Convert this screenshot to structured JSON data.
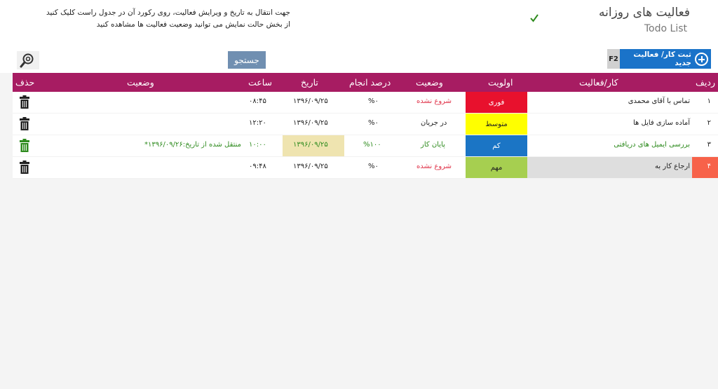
{
  "header": {
    "title": "فعالیت های روزانه",
    "subtitle": "Todo List",
    "hint_line1": "جهت انتقال به تاریخ و ویرایش فعالیت، روی رکورد آن در جدول راست کلیک کنید",
    "hint_line2": "از بخش حالت نمایش می توانید  وضعیت فعالیت ها مشاهده کنید"
  },
  "toolbar": {
    "add_label": "ثبت کار/ فعالیت جدید",
    "add_shortcut": "F2",
    "search_label": "جستجو",
    "search_value": "",
    "search_placeholder": ""
  },
  "table": {
    "columns": {
      "row": "ردیف",
      "task": "کار/فعالیت",
      "priority": "اولویت",
      "status": "وضعیت",
      "percent": "درصد انجام",
      "date": "تاریخ",
      "time": "ساعت",
      "state": "وضعیت",
      "delete": "حذف"
    },
    "rows": [
      {
        "num": "۱",
        "task": "تماس با آقای محمدی",
        "priority": "فوری",
        "priority_color": "#e8112d",
        "priority_text_color": "#ffffff",
        "status": "شروع نشده",
        "percent": "%۰",
        "date": "۱۳۹۶/۰۹/۲۵",
        "time": "۰۸:۴۵",
        "state": ""
      },
      {
        "num": "۲",
        "task": "آماده سازی فایل ها",
        "priority": "متوسط",
        "priority_color": "#ffff00",
        "priority_text_color": "#222222",
        "status": "در جریان",
        "percent": "%۰",
        "date": "۱۳۹۶/۰۹/۲۵",
        "time": "۱۲:۲۰",
        "state": ""
      },
      {
        "num": "۳",
        "task": "بررسی ایمیل های دریافتی",
        "priority": "کم",
        "priority_color": "#1b75c5",
        "priority_text_color": "#ffffff",
        "status": "پایان کار",
        "percent": "%۱۰۰",
        "date": "۱۳۹۶/۰۹/۲۵",
        "time": "۱۰:۰۰",
        "state": "*منتقل شده از تاریخ:۱۳۹۶/۰۹/۲۶"
      },
      {
        "num": "۴",
        "task": "ارجاع کار به",
        "priority": "مهم",
        "priority_color": "#a6cf50",
        "priority_text_color": "#222222",
        "status": "شروع نشده",
        "percent": "%۰",
        "date": "۱۳۹۶/۰۹/۲۵",
        "time": "۰۹:۴۸",
        "state": ""
      }
    ]
  },
  "colors": {
    "header_bar": "#a71c62",
    "status_not_started": "#e0344a",
    "status_done": "#2e8b1e",
    "add_button": "#1a73c9",
    "search_button": "#708fb1"
  },
  "icons": [
    "check-icon",
    "plus-circle-icon",
    "search-gear-icon",
    "trash-icon"
  ]
}
